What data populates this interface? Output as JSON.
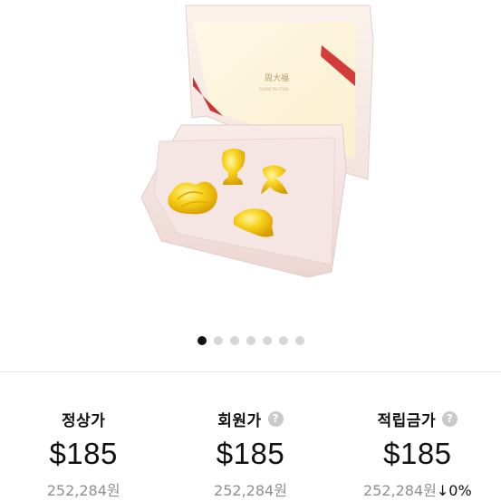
{
  "image": {
    "alt_icon": "product-photo"
  },
  "carousel": {
    "count": 7,
    "active_index": 0
  },
  "prices": [
    {
      "label": "정상가",
      "help": false,
      "usd": "$185",
      "krw": "252,284원",
      "change": ""
    },
    {
      "label": "회원가",
      "help": true,
      "usd": "$185",
      "krw": "252,284원",
      "change": ""
    },
    {
      "label": "적립금가",
      "help": true,
      "usd": "$185",
      "krw": "252,284원",
      "change": "↓0%"
    }
  ],
  "help_glyph": "?",
  "colors": {
    "dot_active": "#111111",
    "dot_inactive": "#d6d6d6",
    "muted_text": "#8f8f8f",
    "box_pink": "#f3e3e1",
    "gold": "#f2c200"
  }
}
